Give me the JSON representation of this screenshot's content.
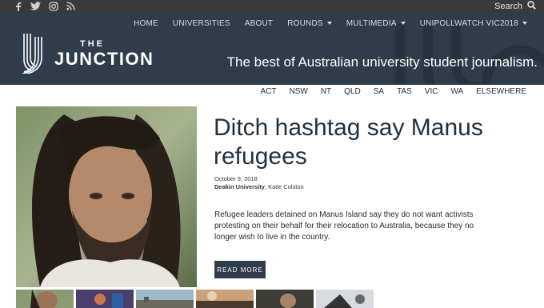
{
  "topbar": {
    "social_icons": [
      "facebook-icon",
      "twitter-icon",
      "instagram-icon",
      "rss-icon"
    ],
    "search_label": "Search"
  },
  "nav": {
    "items": [
      {
        "label": "HOME",
        "dropdown": false
      },
      {
        "label": "UNIVERSITIES",
        "dropdown": false
      },
      {
        "label": "ABOUT",
        "dropdown": false
      },
      {
        "label": "ROUNDS",
        "dropdown": true
      },
      {
        "label": "MULTIMEDIA",
        "dropdown": true
      },
      {
        "label": "UNIPOLLWATCH VIC2018",
        "dropdown": true
      }
    ]
  },
  "brand": {
    "logo_the": "THE",
    "logo_junction": "JUNCTION",
    "tagline": "The best of Australian university student journalism."
  },
  "regions": [
    "ACT",
    "NSW",
    "NT",
    "QLD",
    "SA",
    "TAS",
    "VIC",
    "WA",
    "ELSEWHERE"
  ],
  "article": {
    "title": "Ditch hashtag say Manus refugees",
    "date": "October 9, 2018",
    "university": "Deakin University",
    "byline_sep": ", ",
    "author": "Katie Colston",
    "excerpt": "Refugee leaders detained on Manus Island say they do not want activists protesting on their behalf for their relocation to Australia, because they no longer wish to live in the country.",
    "read_more": "READ MORE"
  },
  "colors": {
    "header_bg": "#2f3c4a",
    "topbar_bg": "#3a3a3a",
    "title": "#1f3140"
  }
}
